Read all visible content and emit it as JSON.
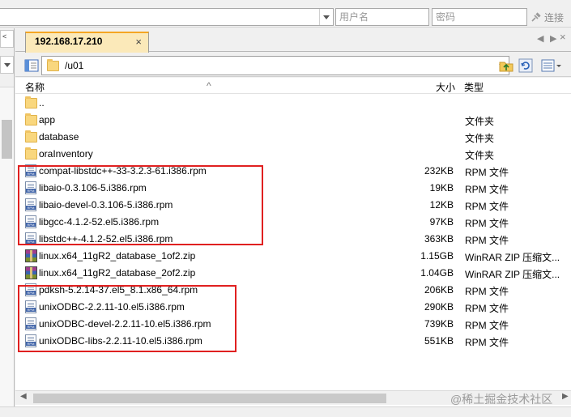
{
  "connection": {
    "host_value": "",
    "username_placeholder": "用户名",
    "password_placeholder": "密码",
    "connect_label": "连接"
  },
  "tab": {
    "title": "192.168.17.210",
    "close_glyph": "×"
  },
  "path": {
    "value": "/u01"
  },
  "columns": {
    "name": "名称",
    "size": "大小",
    "type": "类型"
  },
  "files": [
    {
      "name": "..",
      "size": "",
      "type": "",
      "icon": "folder-icon"
    },
    {
      "name": "app",
      "size": "",
      "type": "文件夹",
      "icon": "folder-icon"
    },
    {
      "name": "database",
      "size": "",
      "type": "文件夹",
      "icon": "folder-icon"
    },
    {
      "name": "oraInventory",
      "size": "",
      "type": "文件夹",
      "icon": "folder-icon"
    },
    {
      "name": "compat-libstdc++-33-3.2.3-61.i386.rpm",
      "size": "232KB",
      "type": "RPM 文件",
      "icon": "rpm-file-icon"
    },
    {
      "name": "libaio-0.3.106-5.i386.rpm",
      "size": "19KB",
      "type": "RPM 文件",
      "icon": "rpm-file-icon"
    },
    {
      "name": "libaio-devel-0.3.106-5.i386.rpm",
      "size": "12KB",
      "type": "RPM 文件",
      "icon": "rpm-file-icon"
    },
    {
      "name": "libgcc-4.1.2-52.el5.i386.rpm",
      "size": "97KB",
      "type": "RPM 文件",
      "icon": "rpm-file-icon"
    },
    {
      "name": "libstdc++-4.1.2-52.el5.i386.rpm",
      "size": "363KB",
      "type": "RPM 文件",
      "icon": "rpm-file-icon"
    },
    {
      "name": "linux.x64_11gR2_database_1of2.zip",
      "size": "1.15GB",
      "type": "WinRAR ZIP 压缩文...",
      "icon": "winrar-zip-icon"
    },
    {
      "name": "linux.x64_11gR2_database_2of2.zip",
      "size": "1.04GB",
      "type": "WinRAR ZIP 压缩文...",
      "icon": "winrar-zip-icon"
    },
    {
      "name": "pdksh-5.2.14-37.el5_8.1.x86_64.rpm",
      "size": "206KB",
      "type": "RPM 文件",
      "icon": "rpm-file-icon"
    },
    {
      "name": "unixODBC-2.2.11-10.el5.i386.rpm",
      "size": "290KB",
      "type": "RPM 文件",
      "icon": "rpm-file-icon"
    },
    {
      "name": "unixODBC-devel-2.2.11-10.el5.i386.rpm",
      "size": "739KB",
      "type": "RPM 文件",
      "icon": "rpm-file-icon"
    },
    {
      "name": "unixODBC-libs-2.2.11-10.el5.i386.rpm",
      "size": "551KB",
      "type": "RPM 文件",
      "icon": "rpm-file-icon"
    }
  ],
  "watermark": "@稀土掘金技术社区",
  "highlight_color": "#e02020"
}
